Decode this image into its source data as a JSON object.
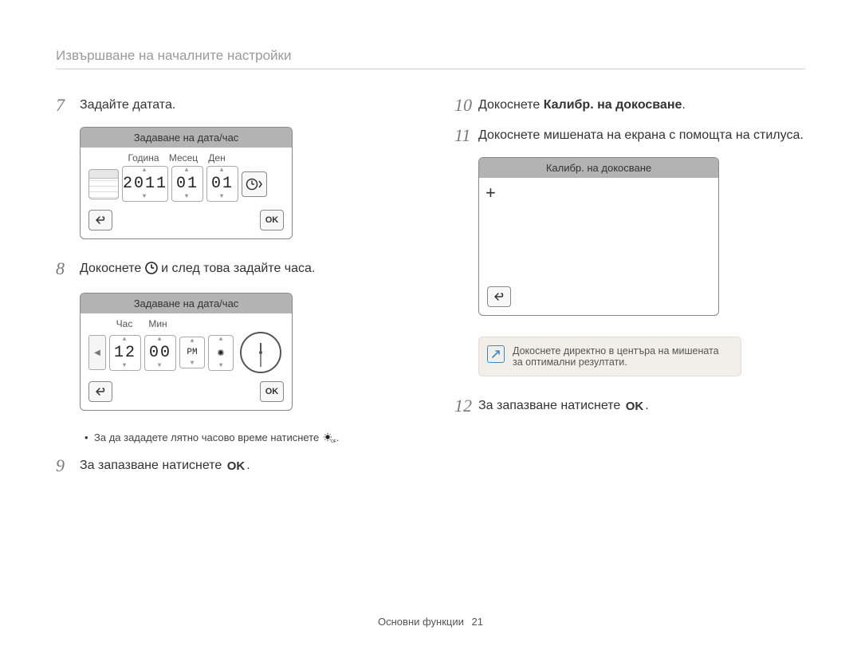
{
  "header": "Извършване на началните настройки",
  "left": {
    "step7": {
      "num": "7",
      "text": "Задайте датата."
    },
    "datePanel": {
      "title": "Задаване на дата/час",
      "labels": {
        "year": "Година",
        "month": "Месец",
        "day": "Ден"
      },
      "values": {
        "year": "2011",
        "month": "01",
        "day": "01"
      },
      "ok": "OK"
    },
    "step8": {
      "num": "8",
      "before": "Докоснете ",
      "after": " и след това задайте часа."
    },
    "timePanel": {
      "title": "Задаване на дата/час",
      "labels": {
        "hour": "Час",
        "min": "Мин"
      },
      "values": {
        "hour": "12",
        "min": "00",
        "ampm": "PM"
      },
      "ok": "OK"
    },
    "dstNote": "За да зададете лятно часово време натиснете ",
    "dstSuffix": ".",
    "step9": {
      "num": "9",
      "before": "За запазване натиснете ",
      "ok": "OK",
      "after": "."
    }
  },
  "right": {
    "step10": {
      "num": "10",
      "before": "Докоснете ",
      "bold": "Калибр. на докосване",
      "after": "."
    },
    "step11": {
      "num": "11",
      "text": "Докоснете мишената на екрана с помощта на стилуса."
    },
    "calibPanel": {
      "title": "Калибр. на докосване",
      "cross": "+"
    },
    "infoNote": "Докоснете директно в центъра на мишената за оптимални резултати.",
    "step12": {
      "num": "12",
      "before": "За запазване натиснете ",
      "ok": "OK",
      "after": "."
    }
  },
  "footer": {
    "label": "Основни функции",
    "page": "21"
  }
}
